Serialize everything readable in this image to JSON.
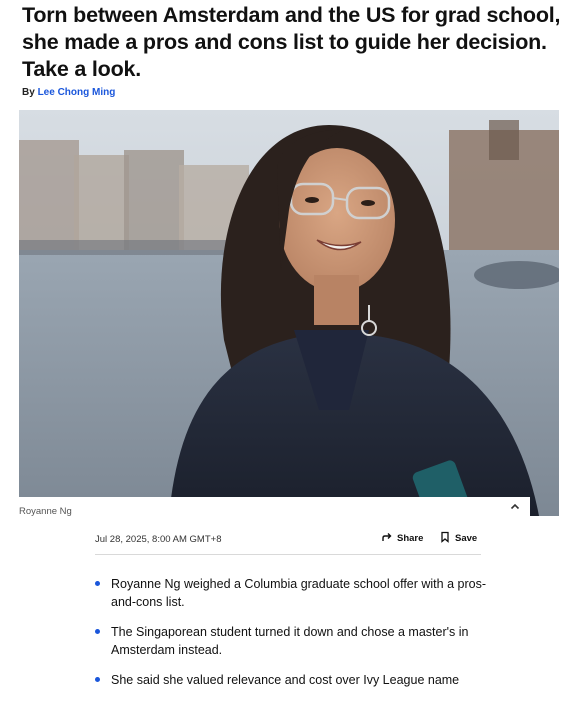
{
  "article": {
    "headline": "Torn between Amsterdam and the US for grad school, she made a pros and cons list to guide her decision. Take a look.",
    "byline_prefix": "By",
    "author": "Lee Chong Ming"
  },
  "hero": {
    "caption": "Royanne Ng"
  },
  "meta": {
    "date": "Jul 28, 2025, 8:00 AM GMT+8",
    "share_label": "Share",
    "save_label": "Save"
  },
  "bullets": [
    "Royanne Ng weighed a Columbia graduate school offer with a pros-and-cons list.",
    "The Singaporean student turned it down and chose a master's in Amsterdam instead.",
    "She said she valued relevance and cost over Ivy League name"
  ],
  "colors": {
    "link": "#1a56db",
    "bullet": "#1a56db",
    "text": "#111111"
  },
  "icons": [
    "share-icon",
    "bookmark-icon",
    "chevron-up-icon"
  ]
}
